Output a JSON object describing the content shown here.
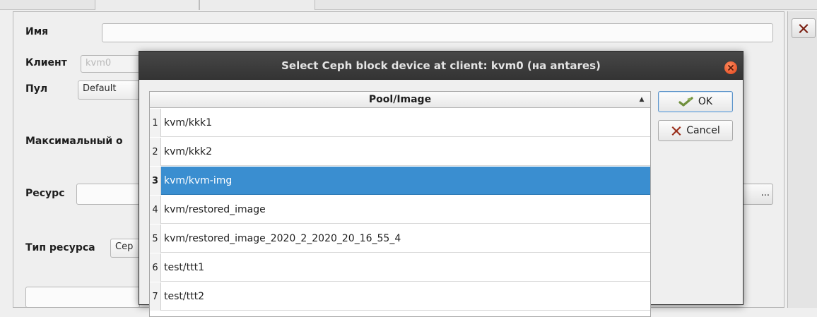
{
  "form": {
    "name_label": "Имя",
    "name_value": "",
    "client_label": "Клиент",
    "client_value": "kvm0",
    "pool_label": "Пул",
    "pool_value": "Default",
    "max_label": "Максимальный о",
    "resource_label": "Ресурс",
    "resource_value": "",
    "resource_browse_label": "...",
    "resource_type_label": "Тип ресурса",
    "resource_type_value": "Cep"
  },
  "dialog": {
    "title": "Select Ceph block device at client: kvm0 (на antares)",
    "column_header": "Pool/Image",
    "sort_indicator": "▲",
    "rows": [
      {
        "num": "1",
        "label": "kvm/kkk1"
      },
      {
        "num": "2",
        "label": "kvm/kkk2"
      },
      {
        "num": "3",
        "label": "kvm/kvm-img"
      },
      {
        "num": "4",
        "label": "kvm/restored_image"
      },
      {
        "num": "5",
        "label": "kvm/restored_image_2020_2_2020_20_16_55_4"
      },
      {
        "num": "6",
        "label": "test/ttt1"
      },
      {
        "num": "7",
        "label": "test/ttt2"
      }
    ],
    "selected_row": 3,
    "ok_label": "OK",
    "cancel_label": "Cancel"
  },
  "icons": {
    "ok": "ok-check-icon",
    "cancel": "cancel-x-icon",
    "close": "window-close-icon"
  },
  "colors": {
    "selection": "#3a8ed0",
    "titlebar": "#3a3a3a",
    "close_button": "#e8542a",
    "cancel_x": "#9a2f1c",
    "ok_icon": "#6f8f3c"
  }
}
